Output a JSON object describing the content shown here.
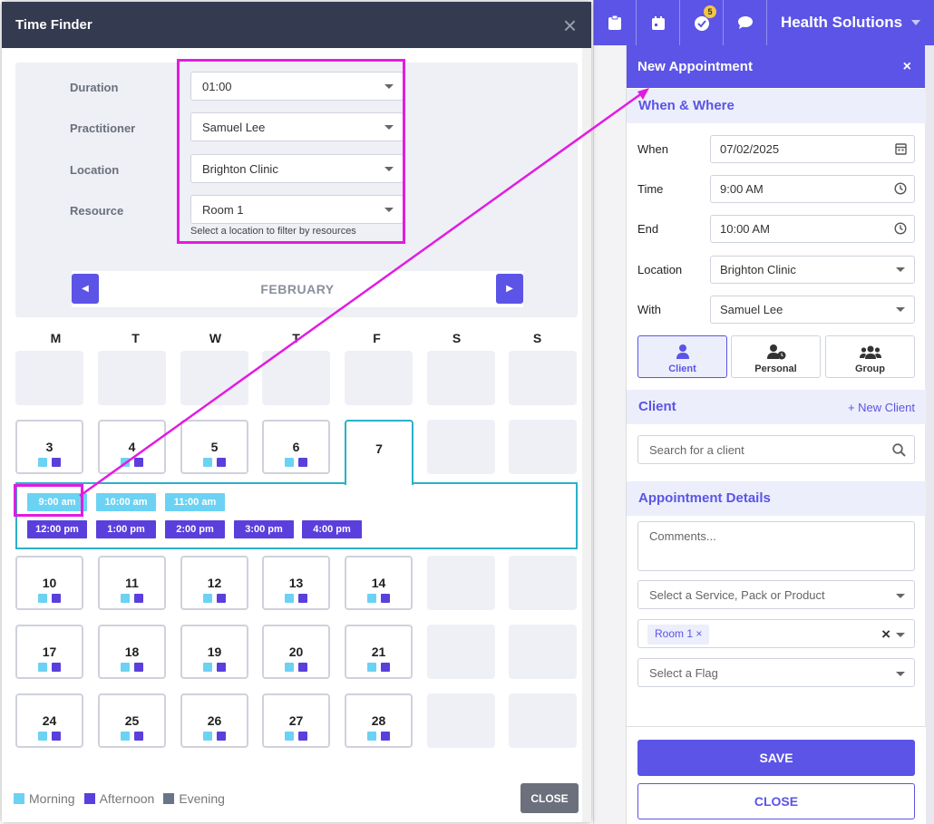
{
  "topbar": {
    "brand": "Health Solutions",
    "icons": [
      "clipboard-icon",
      "calendar-icon",
      "check-circle-icon",
      "chat-icon"
    ],
    "badge_count": "5"
  },
  "time_finder": {
    "title": "Time Finder",
    "close_x": "×",
    "filters": [
      {
        "label": "Duration",
        "value": "01:00"
      },
      {
        "label": "Practitioner",
        "value": "Samuel Lee"
      },
      {
        "label": "Location",
        "value": "Brighton Clinic"
      },
      {
        "label": "Resource",
        "value": "Room 1"
      }
    ],
    "resource_hint": "Select a location to filter by resources",
    "month": "FEBRUARY",
    "weekdays": [
      "M",
      "T",
      "W",
      "T",
      "F",
      "S",
      "S"
    ],
    "selected_day": "7",
    "morning_slots": [
      "9:00 am",
      "10:00 am",
      "11:00 am"
    ],
    "afternoon_slots": [
      "12:00 pm",
      "1:00 pm",
      "2:00 pm",
      "3:00 pm",
      "4:00 pm"
    ],
    "week2_days": [
      "3",
      "4",
      "5",
      "6"
    ],
    "week3_days": [
      "10",
      "11",
      "12",
      "13",
      "14"
    ],
    "week4_days": [
      "17",
      "18",
      "19",
      "20",
      "21"
    ],
    "week5_days": [
      "24",
      "25",
      "26",
      "27",
      "28"
    ],
    "legend": {
      "morning": "Morning",
      "afternoon": "Afternoon",
      "evening": "Evening"
    },
    "close_label": "CLOSE",
    "colors": {
      "morning": "#6cd2f3",
      "afternoon": "#5b3fdc",
      "evening": "#6a7488",
      "highlight": "#e21be2",
      "selected": "#2bb0c9"
    }
  },
  "appointment": {
    "title": "New Appointment",
    "close_x": "×",
    "when_where": "When & Where",
    "when_label": "When",
    "when_value": "07/02/2025",
    "time_label": "Time",
    "time_value": "9:00 AM",
    "end_label": "End",
    "end_value": "10:00 AM",
    "location_label": "Location",
    "location_value": "Brighton Clinic",
    "with_label": "With",
    "with_value": "Samuel Lee",
    "types": [
      "Client",
      "Personal",
      "Group"
    ],
    "client_section": "Client",
    "new_client": "+ New Client",
    "search_placeholder": "Search for a client",
    "details_section": "Appointment Details",
    "comments_placeholder": "Comments...",
    "service_placeholder": "Select a Service, Pack or Product",
    "resource_tag": "Room 1",
    "flag_placeholder": "Select a Flag",
    "save_label": "SAVE",
    "close_label": "CLOSE",
    "accent": "#5b54e6"
  }
}
